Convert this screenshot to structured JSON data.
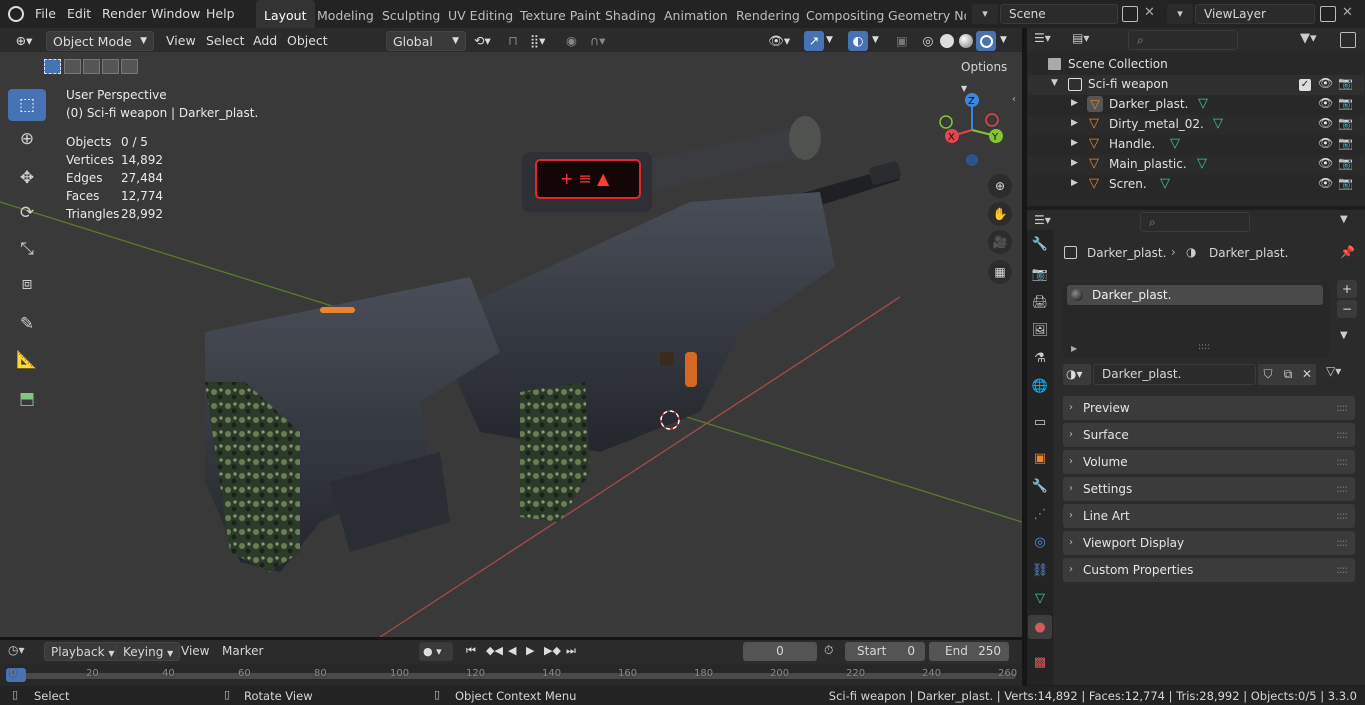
{
  "menu": [
    "File",
    "Edit",
    "Render",
    "Window",
    "Help"
  ],
  "workspaces": [
    "Layout",
    "Modeling",
    "Sculpting",
    "UV Editing",
    "Texture Paint",
    "Shading",
    "Animation",
    "Rendering",
    "Compositing",
    "Geometry Noc"
  ],
  "scene_name": "Scene",
  "view_layer": "ViewLayer",
  "header": {
    "mode": "Object Mode",
    "view": "View",
    "select": "Select",
    "add": "Add",
    "object": "Object",
    "orientation": "Global",
    "options": "Options"
  },
  "viewport": {
    "perspective": "User Perspective",
    "context": "(0) Sci-fi weapon | Darker_plast.",
    "stats": [
      {
        "label": "Objects",
        "value": "0 / 5"
      },
      {
        "label": "Vertices",
        "value": "14,892"
      },
      {
        "label": "Edges",
        "value": "27,484"
      },
      {
        "label": "Faces",
        "value": "12,774"
      },
      {
        "label": "Triangles",
        "value": "28,992"
      }
    ],
    "gizmo": {
      "z": "Z",
      "y": "Y",
      "x": "X"
    }
  },
  "outliner": {
    "root": "Scene Collection",
    "collection": "Sci-fi weapon",
    "items": [
      "Darker_plast.",
      "Dirty_metal_02.",
      "Handle.",
      "Main_plastic.",
      "Scren."
    ]
  },
  "properties": {
    "breadcrumb_object": "Darker_plast.",
    "breadcrumb_material": "Darker_plast.",
    "slot": "Darker_plast.",
    "material_name": "Darker_plast.",
    "panels": [
      "Preview",
      "Surface",
      "Volume",
      "Settings",
      "Line Art",
      "Viewport Display",
      "Custom Properties"
    ]
  },
  "timeline": {
    "playback": "Playback",
    "keying": "Keying",
    "view": "View",
    "marker": "Marker",
    "current_frame": "0",
    "start_label": "Start",
    "start": "0",
    "end_label": "End",
    "end": "250",
    "ticks": [
      "0",
      "20",
      "40",
      "60",
      "80",
      "100",
      "120",
      "140",
      "160",
      "180",
      "200",
      "220",
      "240",
      "260"
    ]
  },
  "status": {
    "select": "Select",
    "rotate": "Rotate View",
    "context_menu": "Object Context Menu",
    "info": "Sci-fi weapon | Darker_plast. | Verts:14,892 | Faces:12,774 | Tris:28,992 | Objects:0/5 | 3.3.0"
  },
  "colors": {
    "accent": "#4772b3",
    "axis_x": "#e5454f",
    "axis_y": "#82c733",
    "axis_z": "#3e85e0",
    "orange": "#e98532"
  }
}
